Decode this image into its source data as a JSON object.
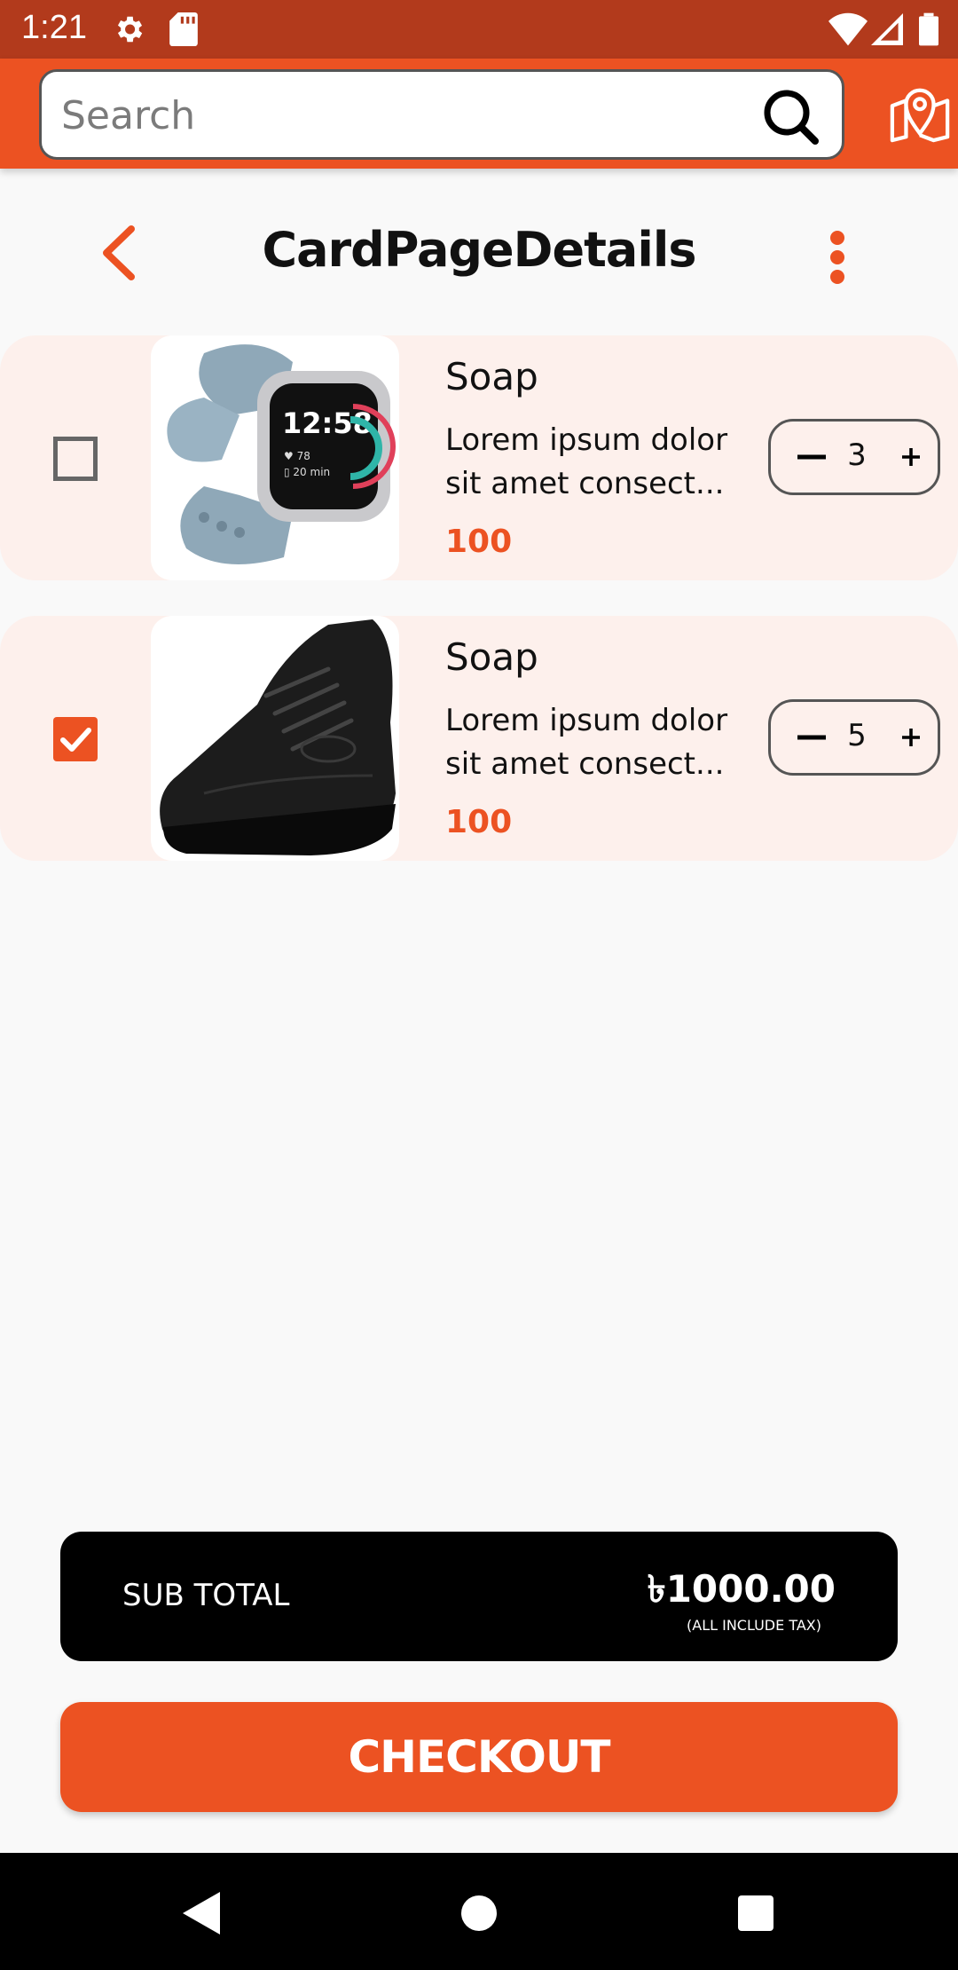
{
  "status_bar": {
    "time": "1:21",
    "icons": [
      "gear-icon",
      "sd-card-icon",
      "wifi-icon",
      "signal-icon",
      "battery-icon"
    ]
  },
  "search": {
    "placeholder": "Search",
    "value": ""
  },
  "header": {
    "title": "CardPageDetails"
  },
  "cart": {
    "items": [
      {
        "name": "Soap",
        "description": "Lorem ipsum dolor\nsit amet consect...",
        "price": "100",
        "quantity": "3",
        "checked": false,
        "image": "smartwatch-image"
      },
      {
        "name": "Soap",
        "description": "Lorem ipsum dolor\nsit amet consect...",
        "price": "100",
        "quantity": "5",
        "checked": true,
        "image": "black-sneaker-image"
      }
    ]
  },
  "subtotal": {
    "label": "SUB TOTAL",
    "amount": "৳1000.00",
    "note": "(ALL INCLUDE TAX)"
  },
  "checkout": {
    "label": "CHECKOUT"
  },
  "colors": {
    "accent": "#ec5222",
    "status_bar": "#b23a1c",
    "item_background": "#fdf0ec",
    "subtotal_background": "#000000"
  }
}
